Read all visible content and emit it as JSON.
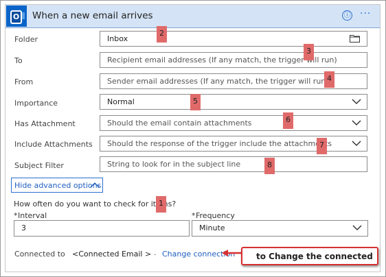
{
  "header": {
    "title": "When a new email arrives",
    "info_icon": "ⓘ",
    "more_icon": "···"
  },
  "fields": {
    "folder": {
      "label": "Folder",
      "value": "Inbox"
    },
    "to": {
      "label": "To",
      "placeholder": "Recipient email addresses (If any match, the trigger will run)"
    },
    "from": {
      "label": "From",
      "placeholder": "Sender email addresses (If any match, the trigger will run)"
    },
    "importance": {
      "label": "Importance",
      "value": "Normal"
    },
    "has_attachment": {
      "label": "Has Attachment",
      "placeholder": "Should the email contain attachments"
    },
    "include_attachments": {
      "label": "Include Attachments",
      "placeholder": "Should the response of the trigger include the attachments"
    },
    "subject_filter": {
      "label": "Subject Filter",
      "placeholder": "String to look for in the subject line"
    }
  },
  "advanced_toggle": "Hide advanced options",
  "recurrence": {
    "question": "How often do you want to check for items?",
    "interval_label": "Interval",
    "interval_value": "3",
    "frequency_label": "Frequency",
    "frequency_value": "Minute",
    "required_mark": "*"
  },
  "connection": {
    "label": "Connected to",
    "value": "<Connected Email >",
    "separator": ".",
    "change_link": "Change connection"
  },
  "callout": "to Change the connected",
  "badges": [
    "1",
    "2",
    "3",
    "4",
    "5",
    "6",
    "7",
    "8"
  ],
  "colors": {
    "header_bg": "#d4e4f6",
    "accent": "#1e5fbf",
    "badge": "#e06a6a",
    "callout_border": "#d83030"
  }
}
